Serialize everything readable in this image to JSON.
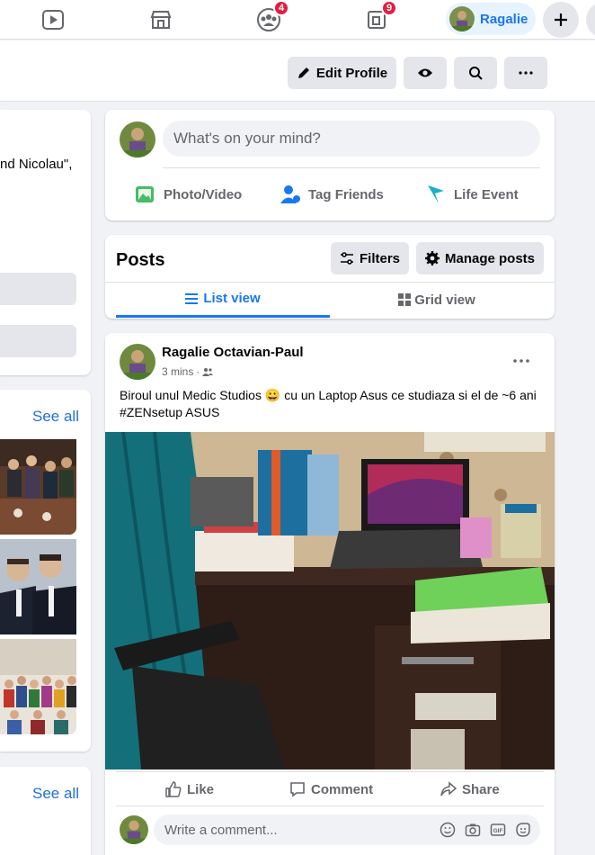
{
  "nav": {
    "badges": {
      "groups": "4",
      "pages": "9"
    },
    "profile_name": "Ragalie"
  },
  "actions": {
    "edit_profile": "Edit Profile"
  },
  "left": {
    "intro_text": "nd Nicolau\",",
    "photos_see_all": "See all",
    "friends_see_all": "See all"
  },
  "composer": {
    "placeholder": "What's on your mind?",
    "photo_video": "Photo/Video",
    "tag_friends": "Tag Friends",
    "life_event": "Life Event"
  },
  "posts_panel": {
    "title": "Posts",
    "filters": "Filters",
    "manage_posts": "Manage posts",
    "list_view": "List view",
    "grid_view": "Grid view"
  },
  "post": {
    "author": "Ragalie Octavian-Paul",
    "time": "3 mins",
    "text_before_emoji": "Biroul unul Medic Studios ",
    "emoji": "😀",
    "text_after_emoji": " cu un Laptop Asus ce studiaza si el de ~6 ani #ZENsetup ASUS",
    "like": "Like",
    "comment": "Comment",
    "share": "Share",
    "comment_placeholder": "Write a comment..."
  },
  "colors": {
    "accent": "#1877f2",
    "badge": "#e41e3f",
    "surface": "#ffffff",
    "background": "#f0f2f5"
  }
}
